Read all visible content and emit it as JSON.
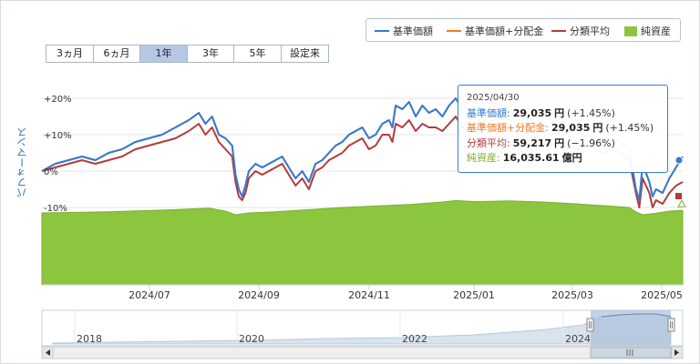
{
  "legend": [
    {
      "label": "基準価額",
      "color": "#2f7bd6",
      "type": "line"
    },
    {
      "label": "基準価額+分配金",
      "color": "#f07a1e",
      "type": "line"
    },
    {
      "label": "分類平均",
      "color": "#b23b3b",
      "type": "line"
    },
    {
      "label": "純資産",
      "color": "#8cc63f",
      "type": "box"
    }
  ],
  "range_buttons": [
    {
      "label": "3ヵ月",
      "active": false
    },
    {
      "label": "6ヵ月",
      "active": false
    },
    {
      "label": "1年",
      "active": true
    },
    {
      "label": "3年",
      "active": false
    },
    {
      "label": "5年",
      "active": false
    },
    {
      "label": "設定来",
      "active": false
    }
  ],
  "tooltip": {
    "date": "2025/04/30",
    "rows": [
      {
        "label": "基準価額:",
        "value": "29,035",
        "unit": "円",
        "change": "(+1.45%)",
        "color": "#2f7bd6"
      },
      {
        "label": "基準価額+分配金:",
        "value": "29,035",
        "unit": "円",
        "change": "(+1.45%)",
        "color": "#f07a1e"
      },
      {
        "label": "分類平均:",
        "value": "59,217",
        "unit": "円",
        "change": "(−1.96%)",
        "color": "#b23b3b"
      },
      {
        "label": "純資産:",
        "value": "16,035.61",
        "unit": "億円",
        "change": "",
        "color": "#7ab02e"
      }
    ]
  },
  "chart_data": {
    "type": "line",
    "ylabel": "パフォーマンス",
    "y_ticks": [
      "+20%",
      "+10%",
      "0%",
      "-10%"
    ],
    "ylim": [
      -32,
      22
    ],
    "x_tick_labels": [
      "2024/07",
      "2024/09",
      "2024/11",
      "2025/01",
      "2025/03",
      "2025/05"
    ],
    "series": [
      {
        "name": "基準価額",
        "color": "#2f7bd6",
        "points": [
          [
            0,
            0
          ],
          [
            4,
            2
          ],
          [
            8,
            3
          ],
          [
            12,
            4
          ],
          [
            16,
            3
          ],
          [
            20,
            5
          ],
          [
            24,
            6
          ],
          [
            28,
            8
          ],
          [
            32,
            9
          ],
          [
            36,
            10
          ],
          [
            40,
            12
          ],
          [
            44,
            14
          ],
          [
            47,
            16
          ],
          [
            49,
            13
          ],
          [
            51,
            15
          ],
          [
            53,
            10
          ],
          [
            55,
            9
          ],
          [
            57,
            7
          ],
          [
            58,
            -1
          ],
          [
            59,
            -5
          ],
          [
            60,
            -7
          ],
          [
            61,
            -4
          ],
          [
            62,
            0
          ],
          [
            64,
            2
          ],
          [
            66,
            1
          ],
          [
            68,
            2
          ],
          [
            70,
            3
          ],
          [
            72,
            4
          ],
          [
            74,
            1
          ],
          [
            76,
            -2
          ],
          [
            78,
            0
          ],
          [
            80,
            -3
          ],
          [
            82,
            2
          ],
          [
            84,
            3
          ],
          [
            86,
            5
          ],
          [
            88,
            7
          ],
          [
            90,
            8
          ],
          [
            92,
            10
          ],
          [
            94,
            11
          ],
          [
            96,
            12
          ],
          [
            98,
            9
          ],
          [
            100,
            10
          ],
          [
            102,
            13
          ],
          [
            104,
            14
          ],
          [
            105,
            12
          ],
          [
            106,
            18
          ],
          [
            108,
            17
          ],
          [
            110,
            19
          ],
          [
            112,
            15
          ],
          [
            114,
            18
          ],
          [
            116,
            16
          ],
          [
            118,
            17
          ],
          [
            120,
            15
          ],
          [
            122,
            18
          ],
          [
            124,
            20
          ],
          [
            126,
            17
          ],
          [
            128,
            19
          ],
          [
            130,
            21
          ],
          [
            132,
            18
          ],
          [
            134,
            20
          ],
          [
            136,
            17
          ],
          [
            138,
            18
          ],
          [
            140,
            15
          ],
          [
            144,
            15
          ],
          [
            148,
            13
          ],
          [
            152,
            10
          ],
          [
            156,
            11
          ],
          [
            160,
            9
          ],
          [
            164,
            10
          ],
          [
            168,
            8
          ],
          [
            172,
            9
          ],
          [
            176,
            6
          ],
          [
            178,
            -5
          ],
          [
            179,
            -8
          ],
          [
            180,
            2
          ],
          [
            182,
            -3
          ],
          [
            183,
            -7
          ],
          [
            184,
            -5
          ],
          [
            186,
            -6
          ],
          [
            188,
            -2
          ],
          [
            190,
            1
          ],
          [
            192,
            4
          ]
        ]
      },
      {
        "name": "基準価額+分配金",
        "color": "#f07a1e",
        "points": [
          [
            0,
            0
          ],
          [
            4,
            2
          ],
          [
            8,
            3
          ],
          [
            12,
            4
          ],
          [
            16,
            3
          ],
          [
            20,
            5
          ],
          [
            24,
            6
          ],
          [
            28,
            8
          ],
          [
            32,
            9
          ],
          [
            36,
            10
          ],
          [
            40,
            12
          ],
          [
            44,
            14
          ],
          [
            47,
            16
          ],
          [
            49,
            13
          ],
          [
            51,
            15
          ],
          [
            53,
            10
          ],
          [
            55,
            9
          ],
          [
            57,
            7
          ],
          [
            58,
            -1
          ],
          [
            59,
            -5
          ],
          [
            60,
            -7
          ],
          [
            61,
            -4
          ],
          [
            62,
            0
          ],
          [
            64,
            2
          ],
          [
            66,
            1
          ],
          [
            68,
            2
          ],
          [
            70,
            3
          ],
          [
            72,
            4
          ],
          [
            74,
            1
          ],
          [
            76,
            -2
          ],
          [
            78,
            0
          ],
          [
            80,
            -3
          ],
          [
            82,
            2
          ],
          [
            84,
            3
          ],
          [
            86,
            5
          ],
          [
            88,
            7
          ],
          [
            90,
            8
          ],
          [
            92,
            10
          ],
          [
            94,
            11
          ],
          [
            96,
            12
          ],
          [
            98,
            9
          ],
          [
            100,
            10
          ],
          [
            102,
            13
          ],
          [
            104,
            14
          ],
          [
            105,
            12
          ],
          [
            106,
            18
          ],
          [
            108,
            17
          ],
          [
            110,
            19
          ],
          [
            112,
            15
          ],
          [
            114,
            18
          ],
          [
            116,
            16
          ],
          [
            118,
            17
          ],
          [
            120,
            15
          ],
          [
            122,
            18
          ],
          [
            124,
            20
          ],
          [
            126,
            17
          ],
          [
            128,
            19
          ],
          [
            130,
            21
          ],
          [
            132,
            18
          ],
          [
            134,
            20
          ],
          [
            136,
            17
          ],
          [
            138,
            18
          ],
          [
            140,
            15
          ],
          [
            144,
            15
          ],
          [
            148,
            13
          ],
          [
            152,
            10
          ],
          [
            156,
            11
          ],
          [
            160,
            9
          ],
          [
            164,
            10
          ],
          [
            168,
            8
          ],
          [
            172,
            9
          ],
          [
            176,
            6
          ],
          [
            178,
            -5
          ],
          [
            179,
            -8
          ],
          [
            180,
            2
          ],
          [
            182,
            -3
          ],
          [
            183,
            -7
          ],
          [
            184,
            -5
          ],
          [
            186,
            -6
          ],
          [
            188,
            -2
          ],
          [
            190,
            1
          ],
          [
            192,
            4
          ]
        ]
      },
      {
        "name": "分類平均",
        "color": "#b23b3b",
        "points": [
          [
            0,
            0
          ],
          [
            4,
            1
          ],
          [
            8,
            2
          ],
          [
            12,
            3
          ],
          [
            16,
            2
          ],
          [
            20,
            3
          ],
          [
            24,
            4
          ],
          [
            28,
            6
          ],
          [
            32,
            7
          ],
          [
            36,
            8
          ],
          [
            40,
            9
          ],
          [
            44,
            11
          ],
          [
            47,
            13
          ],
          [
            49,
            10
          ],
          [
            51,
            12
          ],
          [
            53,
            8
          ],
          [
            55,
            6
          ],
          [
            57,
            4
          ],
          [
            58,
            -3
          ],
          [
            59,
            -7
          ],
          [
            60,
            -8
          ],
          [
            61,
            -6
          ],
          [
            62,
            -2
          ],
          [
            64,
            0
          ],
          [
            66,
            -1
          ],
          [
            68,
            0
          ],
          [
            70,
            1
          ],
          [
            72,
            2
          ],
          [
            74,
            -1
          ],
          [
            76,
            -4
          ],
          [
            78,
            -2
          ],
          [
            80,
            -5
          ],
          [
            82,
            0
          ],
          [
            84,
            1
          ],
          [
            86,
            3
          ],
          [
            88,
            4
          ],
          [
            90,
            5
          ],
          [
            92,
            7
          ],
          [
            94,
            8
          ],
          [
            96,
            9
          ],
          [
            98,
            6
          ],
          [
            100,
            7
          ],
          [
            102,
            10
          ],
          [
            104,
            10
          ],
          [
            105,
            8
          ],
          [
            106,
            13
          ],
          [
            108,
            12
          ],
          [
            110,
            14
          ],
          [
            112,
            11
          ],
          [
            114,
            13
          ],
          [
            116,
            12
          ],
          [
            118,
            12
          ],
          [
            120,
            11
          ],
          [
            122,
            13
          ],
          [
            124,
            15
          ],
          [
            126,
            12
          ],
          [
            128,
            14
          ],
          [
            130,
            15
          ],
          [
            132,
            13
          ],
          [
            134,
            15
          ],
          [
            136,
            12
          ],
          [
            138,
            13
          ],
          [
            140,
            11
          ],
          [
            144,
            11
          ],
          [
            148,
            9
          ],
          [
            152,
            7
          ],
          [
            156,
            8
          ],
          [
            160,
            6
          ],
          [
            164,
            7
          ],
          [
            168,
            5
          ],
          [
            172,
            6
          ],
          [
            176,
            3
          ],
          [
            178,
            -6
          ],
          [
            179,
            -10
          ],
          [
            180,
            -2
          ],
          [
            182,
            -6
          ],
          [
            183,
            -10
          ],
          [
            184,
            -8
          ],
          [
            186,
            -9
          ],
          [
            188,
            -6
          ],
          [
            190,
            -4
          ],
          [
            192,
            -3
          ]
        ]
      },
      {
        "name": "純資産",
        "color": "#8cc63f",
        "type": "area",
        "points": [
          [
            0,
            -11.5
          ],
          [
            20,
            -11.2
          ],
          [
            40,
            -10.6
          ],
          [
            50,
            -10.2
          ],
          [
            55,
            -11
          ],
          [
            58,
            -12
          ],
          [
            62,
            -11.5
          ],
          [
            70,
            -11.2
          ],
          [
            80,
            -10.6
          ],
          [
            90,
            -10
          ],
          [
            100,
            -9.6
          ],
          [
            110,
            -9.2
          ],
          [
            120,
            -8.5
          ],
          [
            124,
            -8.1
          ],
          [
            130,
            -8.4
          ],
          [
            140,
            -8.2
          ],
          [
            150,
            -8.5
          ],
          [
            160,
            -9
          ],
          [
            170,
            -9.6
          ],
          [
            176,
            -10
          ],
          [
            178,
            -11.2
          ],
          [
            180,
            -12
          ],
          [
            184,
            -11.6
          ],
          [
            188,
            -11
          ],
          [
            192,
            -10.8
          ]
        ]
      }
    ],
    "navigator_labels": [
      "2018",
      "2020",
      "2022",
      "2024"
    ]
  }
}
